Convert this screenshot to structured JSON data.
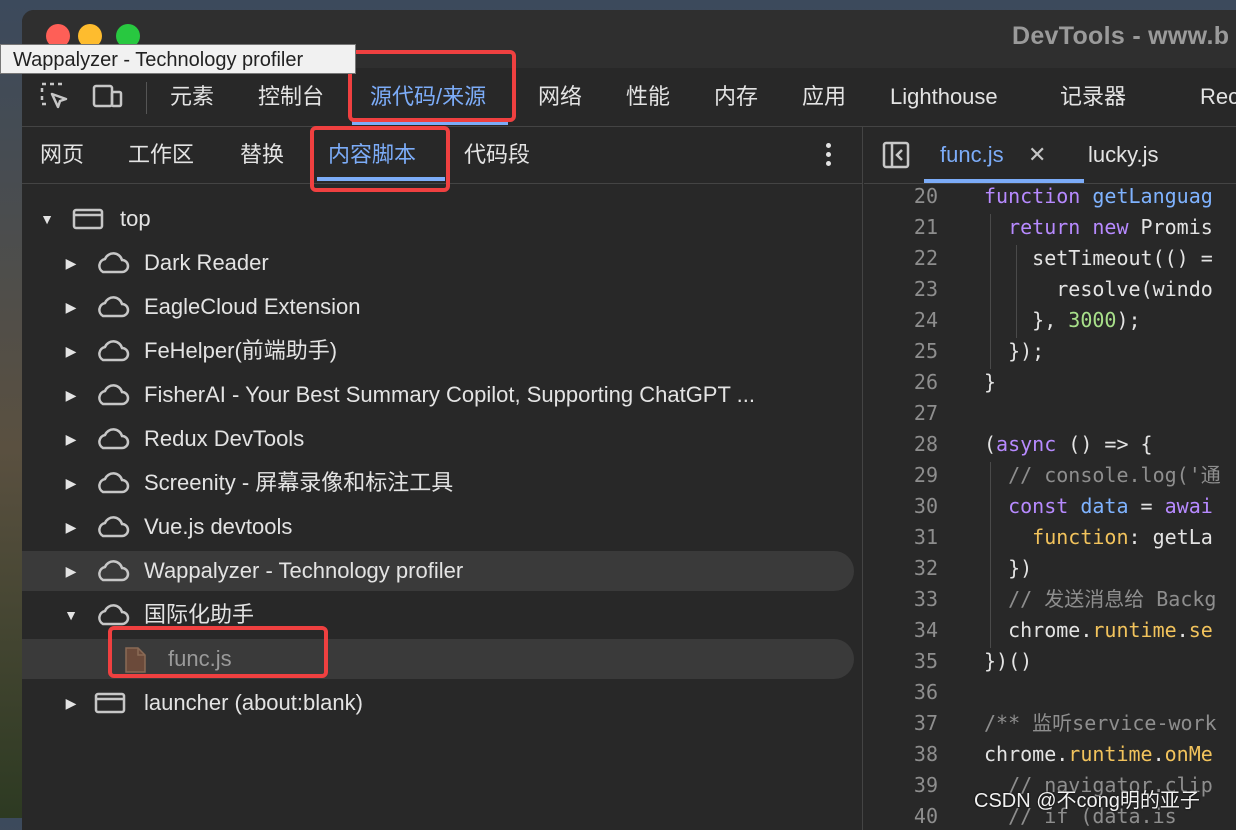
{
  "window": {
    "title": "DevTools - www.b"
  },
  "tooltip": "Wappalyzer - Technology profiler",
  "main_tabs": [
    {
      "label": "元素"
    },
    {
      "label": "控制台"
    },
    {
      "label": "源代码/来源"
    },
    {
      "label": "网络"
    },
    {
      "label": "性能"
    },
    {
      "label": "内存"
    },
    {
      "label": "应用"
    },
    {
      "label": "Lighthouse"
    },
    {
      "label": "记录器"
    },
    {
      "label": "Rec"
    }
  ],
  "main_tabs_active": "源代码/来源",
  "sub_tabs": [
    {
      "label": "网页"
    },
    {
      "label": "工作区"
    },
    {
      "label": "替换"
    },
    {
      "label": "内容脚本"
    },
    {
      "label": "代码段"
    }
  ],
  "sub_tabs_active": "内容脚本",
  "tree": [
    {
      "label": "top",
      "icon": "frame-icon",
      "expanded": true
    },
    {
      "label": "Dark Reader",
      "icon": "cloud-icon"
    },
    {
      "label": "EagleCloud Extension",
      "icon": "cloud-icon"
    },
    {
      "label": "FeHelper(前端助手)",
      "icon": "cloud-icon"
    },
    {
      "label": "FisherAI - Your Best Summary Copilot, Supporting ChatGPT ...",
      "icon": "cloud-icon"
    },
    {
      "label": "Redux DevTools",
      "icon": "cloud-icon"
    },
    {
      "label": "Screenity - 屏幕录像和标注工具",
      "icon": "cloud-icon"
    },
    {
      "label": "Vue.js devtools",
      "icon": "cloud-icon"
    },
    {
      "label": "Wappalyzer - Technology profiler",
      "icon": "cloud-icon",
      "hovered": true
    },
    {
      "label": "国际化助手",
      "icon": "cloud-icon",
      "expanded": true
    },
    {
      "label": "func.js",
      "icon": "file-icon",
      "selected": true
    },
    {
      "label": "launcher (about:blank)",
      "icon": "frame-icon"
    }
  ],
  "editor_tabs": [
    {
      "label": "func.js",
      "active": true
    },
    {
      "label": "lucky.js",
      "active": false
    }
  ],
  "code_lines": [
    {
      "n": "20",
      "tokens": [
        [
          "kw",
          "function "
        ],
        [
          "fn",
          "getLanguag"
        ]
      ]
    },
    {
      "n": "21",
      "tokens": [
        [
          "t",
          "  "
        ],
        [
          "kw",
          "return new "
        ],
        [
          "t",
          "Promis"
        ]
      ]
    },
    {
      "n": "22",
      "tokens": [
        [
          "t",
          "    setTimeout(() ="
        ]
      ]
    },
    {
      "n": "23",
      "tokens": [
        [
          "t",
          "      resolve(windo"
        ]
      ]
    },
    {
      "n": "24",
      "tokens": [
        [
          "t",
          "    }, "
        ],
        [
          "nm",
          "3000"
        ],
        [
          "t",
          ");"
        ]
      ]
    },
    {
      "n": "25",
      "tokens": [
        [
          "t",
          "  });"
        ]
      ]
    },
    {
      "n": "26",
      "tokens": [
        [
          "t",
          "}"
        ]
      ]
    },
    {
      "n": "27",
      "tokens": []
    },
    {
      "n": "28",
      "tokens": [
        [
          "t",
          "("
        ],
        [
          "kw",
          "async"
        ],
        [
          "t",
          " () => {"
        ]
      ]
    },
    {
      "n": "29",
      "tokens": [
        [
          "cm",
          "  // console.log('通"
        ]
      ]
    },
    {
      "n": "30",
      "tokens": [
        [
          "t",
          "  "
        ],
        [
          "kw",
          "const "
        ],
        [
          "fn",
          "data"
        ],
        [
          "t",
          " = "
        ],
        [
          "kw",
          "awai"
        ]
      ]
    },
    {
      "n": "31",
      "tokens": [
        [
          "t",
          "    "
        ],
        [
          "pr",
          "function"
        ],
        [
          "t",
          ": getLa"
        ]
      ]
    },
    {
      "n": "32",
      "tokens": [
        [
          "t",
          "  })"
        ]
      ]
    },
    {
      "n": "33",
      "tokens": [
        [
          "cm",
          "  // 发送消息给 Backg"
        ]
      ]
    },
    {
      "n": "34",
      "tokens": [
        [
          "t",
          "  chrome."
        ],
        [
          "pr",
          "runtime"
        ],
        [
          "t",
          "."
        ],
        [
          "pr",
          "se"
        ]
      ]
    },
    {
      "n": "35",
      "tokens": [
        [
          "t",
          "})()"
        ]
      ]
    },
    {
      "n": "36",
      "tokens": []
    },
    {
      "n": "37",
      "tokens": [
        [
          "cm",
          "/** 监听service-work"
        ]
      ]
    },
    {
      "n": "38",
      "tokens": [
        [
          "t",
          "chrome."
        ],
        [
          "pr",
          "runtime"
        ],
        [
          "t",
          "."
        ],
        [
          "pr",
          "onMe"
        ]
      ]
    },
    {
      "n": "39",
      "tokens": [
        [
          "cm",
          "  // navigator.clip"
        ]
      ]
    },
    {
      "n": "40",
      "tokens": [
        [
          "cm",
          "  // if (data.is"
        ]
      ]
    }
  ],
  "watermark": "CSDN @不cong明的亚子",
  "colors": {
    "accent": "#7cacf8",
    "highlight_box": "#ef4040",
    "panel_bg": "#282828"
  }
}
